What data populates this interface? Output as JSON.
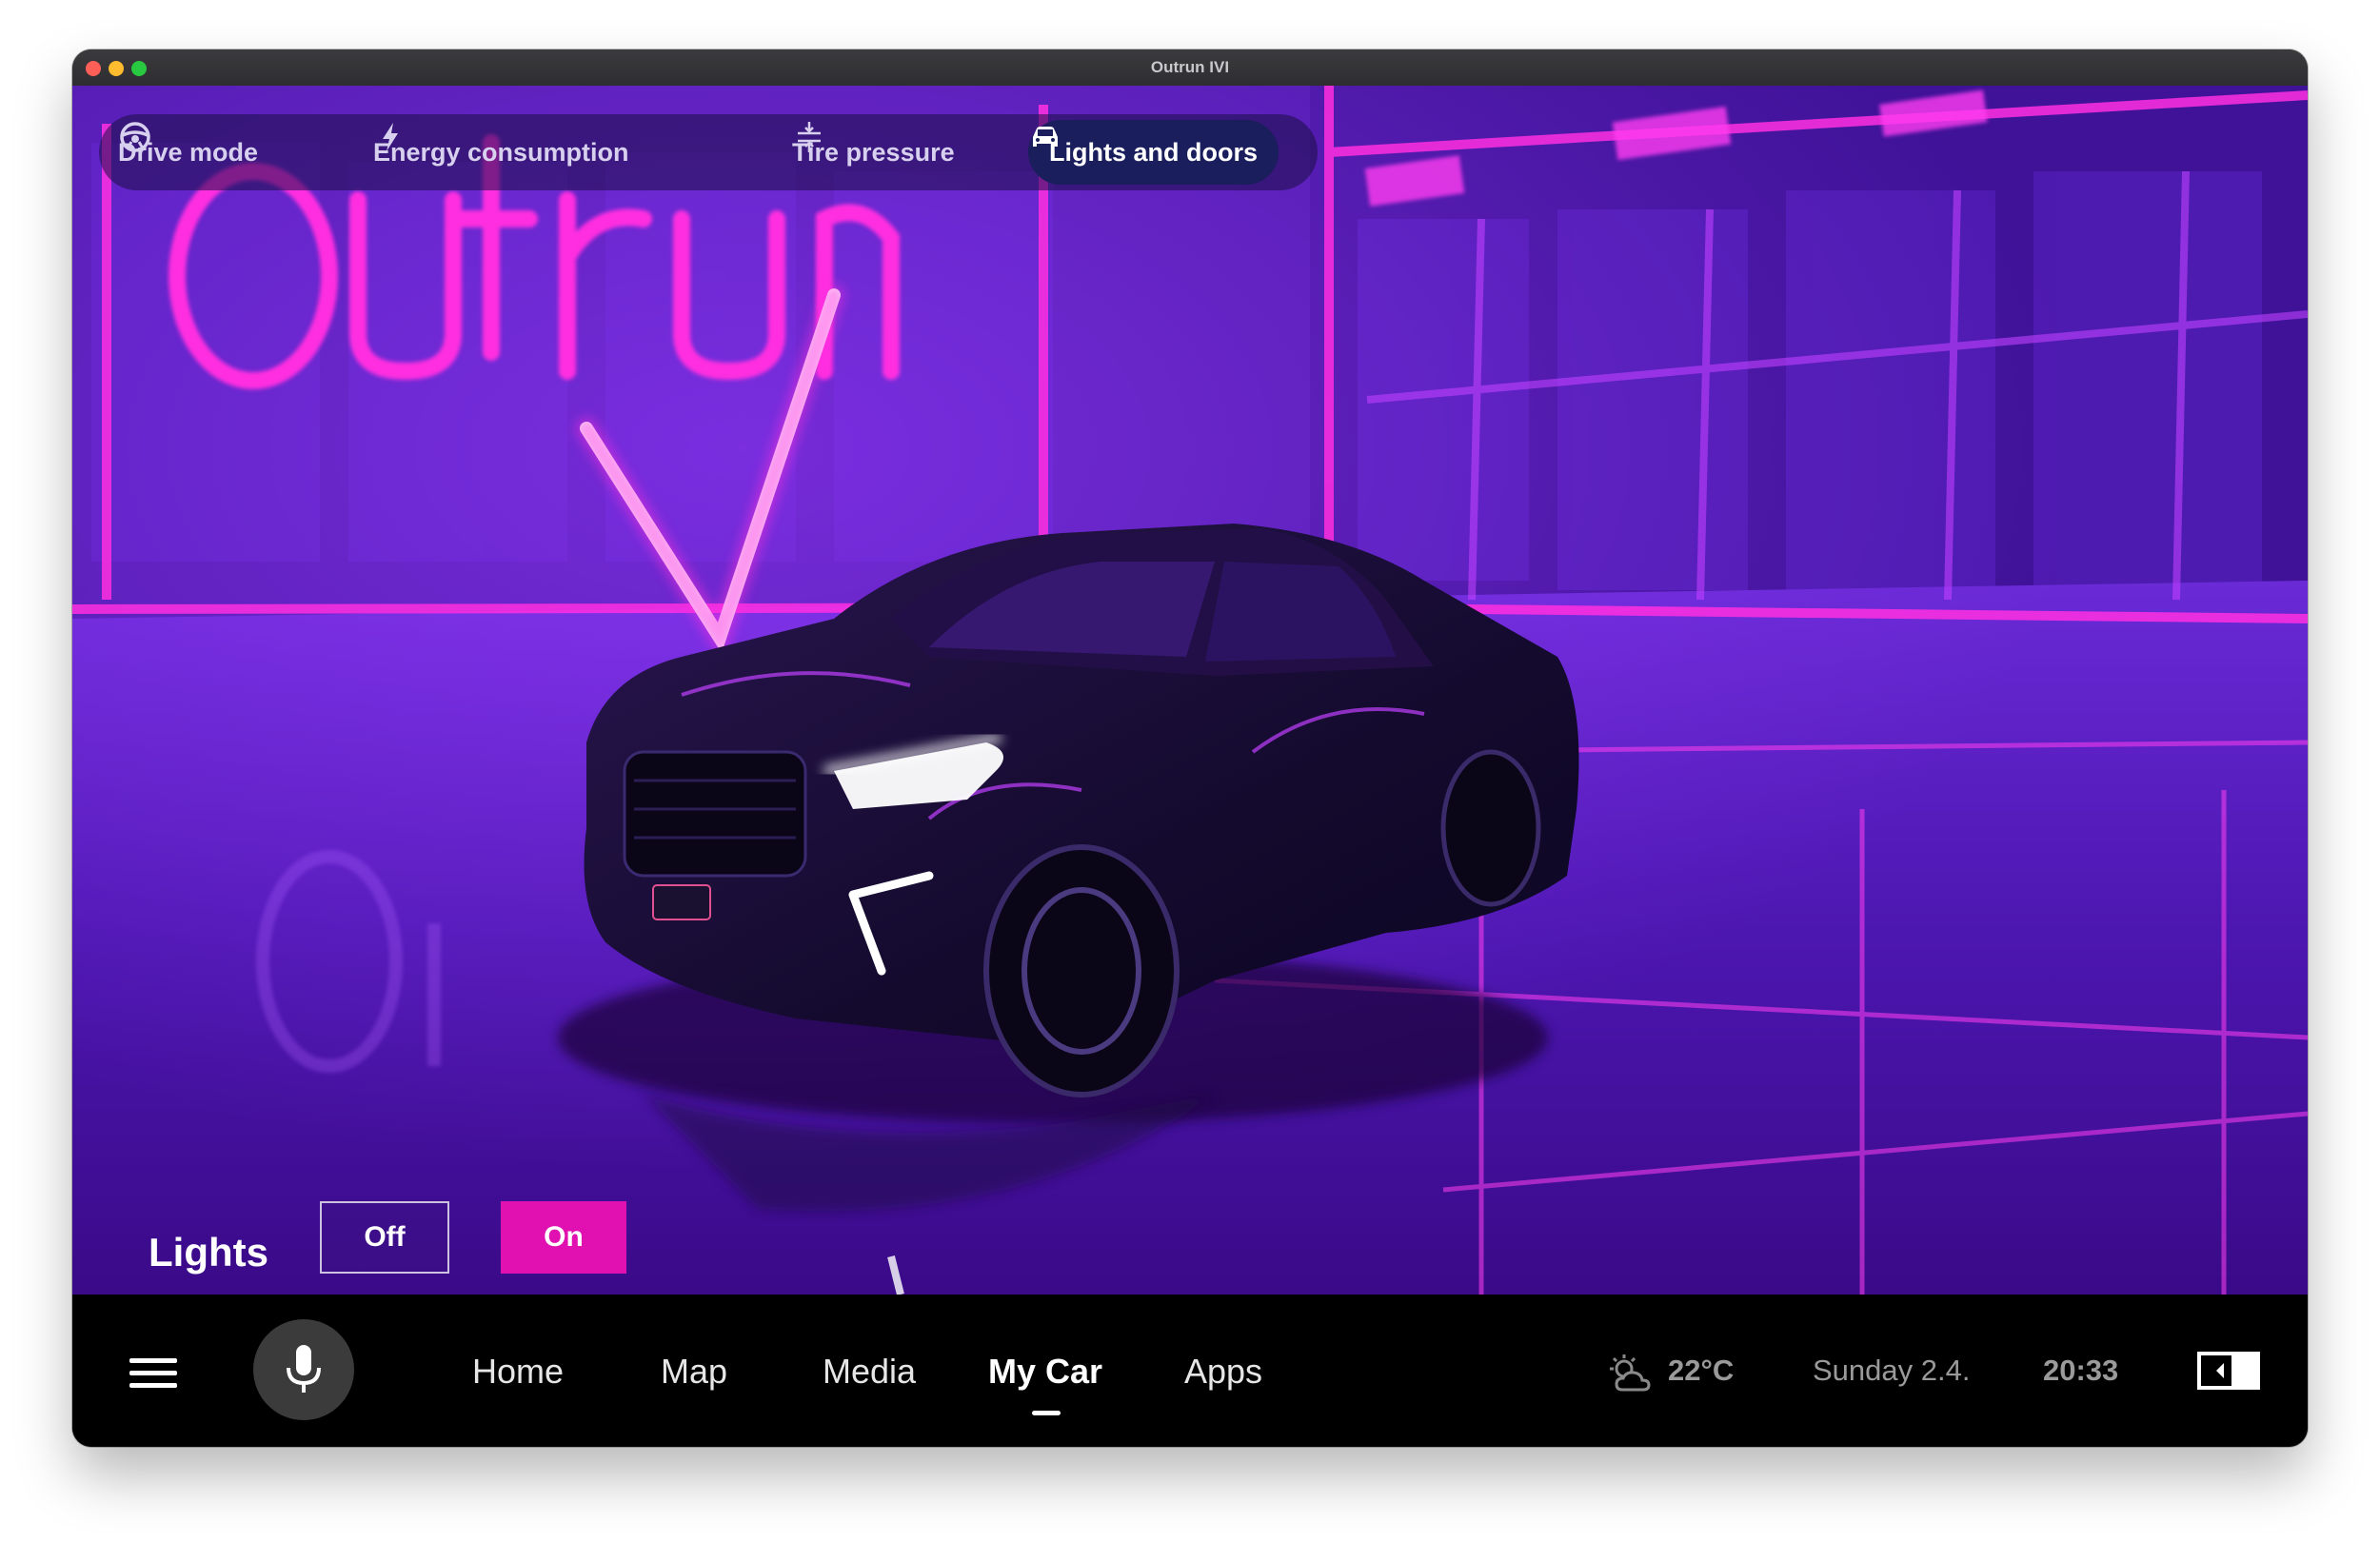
{
  "window": {
    "title": "Outrun IVI"
  },
  "tabs": [
    {
      "label": "Drive mode",
      "icon": "steering-wheel-icon",
      "active": false
    },
    {
      "label": "Energy consumption",
      "icon": "lightning-icon",
      "active": false
    },
    {
      "label": "Tire pressure",
      "icon": "tire-pressure-icon",
      "active": false
    },
    {
      "label": "Lights and doors",
      "icon": "car-front-icon",
      "active": true
    }
  ],
  "lights": {
    "label": "Lights",
    "off_label": "Off",
    "on_label": "On",
    "selected": "On"
  },
  "nav": {
    "items": [
      "Home",
      "Map",
      "Media",
      "My Car",
      "Apps"
    ],
    "active": "My Car"
  },
  "status": {
    "temperature": "22°C",
    "date": "Sunday 2.4.",
    "time": "20:33"
  },
  "colors": {
    "accent": "#e011b0",
    "active_tab_bg": "#1a1e5c",
    "bar_bg": "#000000",
    "neon": "#ff2fe0"
  }
}
